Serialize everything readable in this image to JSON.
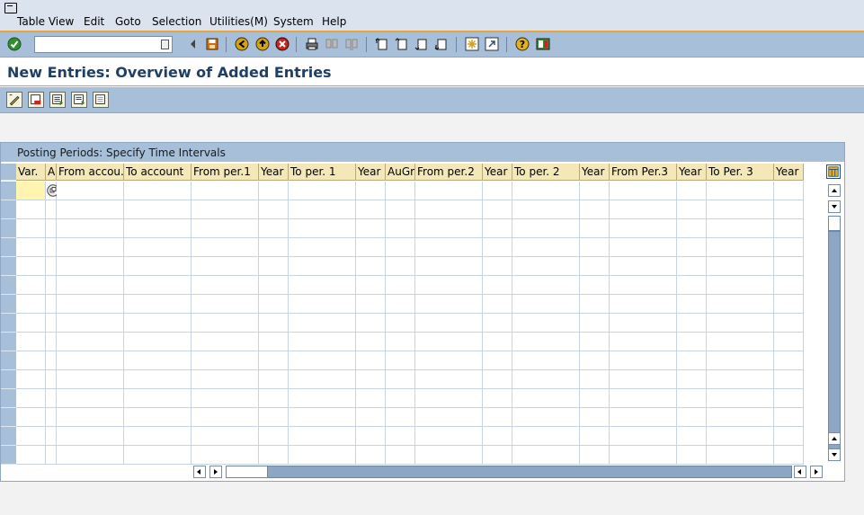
{
  "menu": {
    "items": [
      "Table View",
      "Edit",
      "Goto",
      "Selection",
      "Utilities(M)",
      "System",
      "Help"
    ]
  },
  "toolbar": {
    "command_value": "",
    "icons": [
      "enter-icon",
      "back-arrow-icon",
      "save-icon",
      "back-icon",
      "exit-icon",
      "cancel-icon",
      "print-icon",
      "find-icon",
      "find-next-icon",
      "first-page-icon",
      "previous-page-icon",
      "next-page-icon",
      "last-page-icon",
      "create-session-icon",
      "shortcut-icon",
      "help-icon",
      "customize-layout-icon"
    ]
  },
  "title": "New Entries: Overview of Added Entries",
  "app_toolbar": {
    "icons": [
      "change-display-icon",
      "delete-icon",
      "select-all-icon",
      "select-block-icon",
      "deselect-all-icon"
    ]
  },
  "table": {
    "title": "Posting Periods: Specify Time Intervals",
    "columns": [
      "Var.",
      "A",
      "From accou...",
      "To account",
      "From per.1",
      "Year",
      "To per. 1",
      "Year",
      "AuGr",
      "From per.2",
      "Year",
      "To per. 2",
      "Year",
      "From Per.3",
      "Year",
      "To Per. 3",
      "Year"
    ],
    "row_count": 15
  },
  "colors": {
    "header_bg": "#f4e8b8",
    "toolbar_bg": "#a7bfd9",
    "title_color": "#1e3f66",
    "input_cell_bg": "#fff5b0"
  }
}
